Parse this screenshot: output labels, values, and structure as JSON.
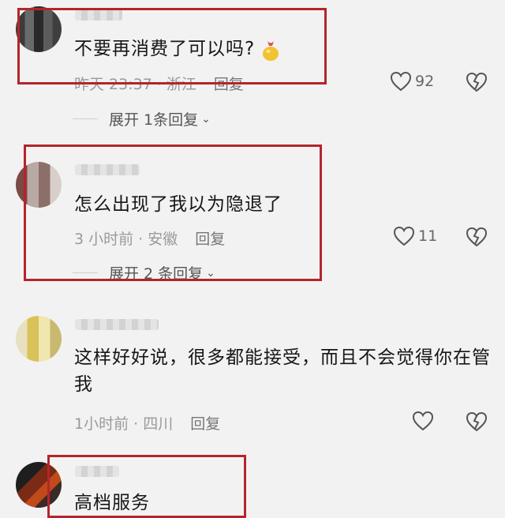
{
  "comments": [
    {
      "text": "不要再消费了可以吗?",
      "meta": "昨天 23:37 · 浙江",
      "reply": "回复",
      "likes": "92",
      "expand": "展开 1条回复"
    },
    {
      "text": "怎么出现了我以为隐退了",
      "meta": "3 小时前 · 安徽",
      "reply": "回复",
      "likes": "11",
      "expand": "展开 2 条回复"
    },
    {
      "text": "这样好好说，很多都能接受，而且不会觉得你在管我",
      "meta": "1小时前 · 四川",
      "reply": "回复",
      "likes": "",
      "expand": ""
    },
    {
      "text": "高档服务",
      "meta": "",
      "reply": "",
      "likes": "",
      "expand": ""
    }
  ],
  "icons": {
    "like": "heart-outline-icon",
    "dislike": "broken-heart-icon",
    "expand": "chevron-down-icon",
    "emoji": "gold-pouch-emoji"
  },
  "colors": {
    "highlight_box": "#b4252b",
    "background": "#f2f2f2"
  }
}
